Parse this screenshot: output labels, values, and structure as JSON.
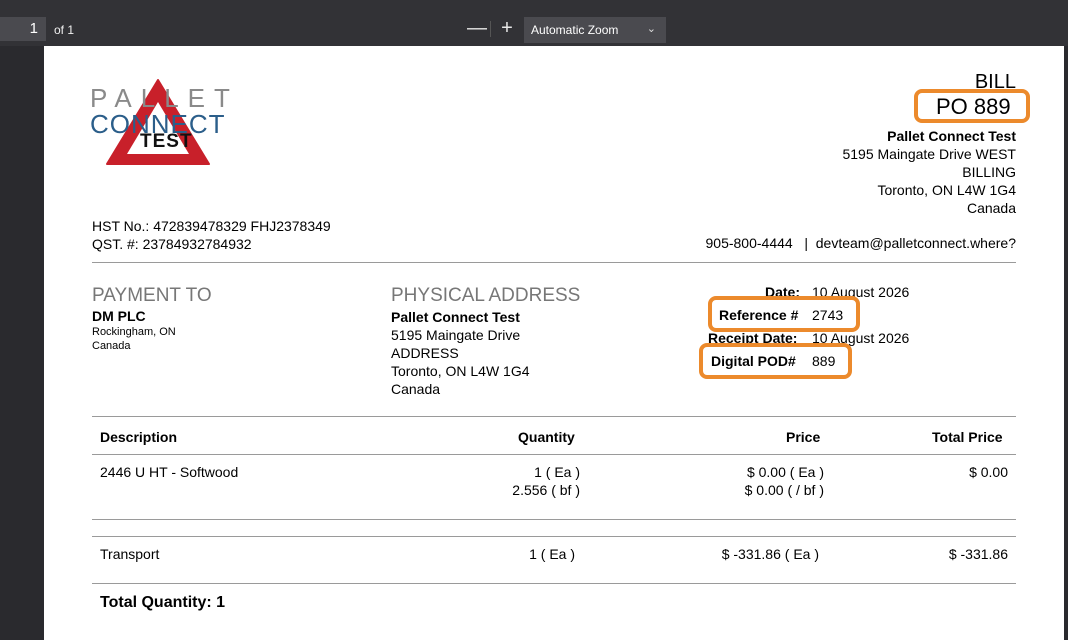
{
  "toolbar": {
    "page_number": "1",
    "page_count": "of 1",
    "zoom_out_label": "—",
    "zoom_in_label": "+",
    "zoom_value": "Automatic Zoom"
  },
  "logo": {
    "line1": "PALLET",
    "line2": "CONNECT",
    "word": "TEST",
    "colors": {
      "red": "#c8202a",
      "blue": "#2b5e8a",
      "gray": "#8a8a8a"
    }
  },
  "header": {
    "doc_type": "BILL",
    "po": "PO  889",
    "company": {
      "name": "Pallet Connect Test",
      "address1": "5195 Maingate Drive WEST",
      "address2": "BILLING",
      "city_line": "Toronto, ON L4W 1G4",
      "country": "Canada"
    },
    "hst": "HST No.: 472839478329 FHJ2378349",
    "qst": "QST. #: 23784932784932",
    "contact": "905-800-4444   |  devteam@palletconnect.where?"
  },
  "payment_to": {
    "title": "PAYMENT TO",
    "name": "DM PLC",
    "city": "Rockingham, ON",
    "country": "Canada"
  },
  "physical_address": {
    "title": "PHYSICAL ADDRESS",
    "name": "Pallet Connect Test",
    "address1": "5195 Maingate Drive",
    "address2": "ADDRESS",
    "city_line": "Toronto, ON L4W 1G4",
    "country": "Canada"
  },
  "details": {
    "date_label": "Date:",
    "date_value": "10 August 2026",
    "ref_label": "Reference #",
    "ref_value": "2743",
    "receipt_label": "Receipt Date:",
    "receipt_value": "10 August 2026",
    "pod_label": "Digital POD#",
    "pod_value": "889",
    "highlight_color": "#ec8a2c"
  },
  "table": {
    "headers": {
      "description": "Description",
      "quantity": "Quantity",
      "price": "Price",
      "total": "Total Price"
    },
    "rows": [
      {
        "description": "2446 U HT - Softwood",
        "qty1": "1 ( Ea )",
        "qty2": "2.556 ( bf )",
        "price1": "$ 0.00 ( Ea )",
        "price2": "$ 0.00 ( / bf )",
        "total": "$ 0.00"
      },
      {
        "description": "Transport",
        "qty1": "1 ( Ea )",
        "price1": "$ -331.86 ( Ea )",
        "total": "$ -331.86"
      }
    ],
    "total_quantity": "Total Quantity: 1"
  }
}
